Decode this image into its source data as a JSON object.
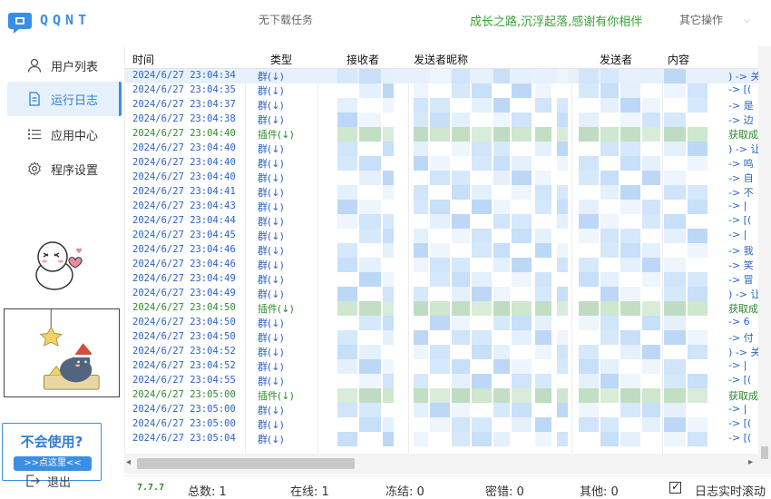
{
  "app": {
    "logo_text": "QQNT"
  },
  "topbar": {
    "task_status": "无下载任务",
    "slogan": "成长之路,沉浮起落,感谢有你相伴",
    "other_ops": "其它操作",
    "other_chev": "⌵"
  },
  "sidebar": {
    "items": [
      {
        "label": "用户列表",
        "icon": "user-icon"
      },
      {
        "label": "运行日志",
        "icon": "log-icon",
        "active": true
      },
      {
        "label": "应用中心",
        "icon": "list-icon"
      },
      {
        "label": "程序设置",
        "icon": "gear-icon"
      }
    ],
    "help_question": "不会使用?",
    "help_button": ">>点这里<<",
    "logout": "退出"
  },
  "grid": {
    "columns": [
      "时间",
      "类型",
      "接收者",
      "发送者昵称",
      "发送者",
      "内容"
    ],
    "rows": [
      {
        "time": "2024/6/27 23:04:34",
        "type": "群(↓)",
        "content": ") -> 关",
        "kind": "blue"
      },
      {
        "time": "2024/6/27 23:04:35",
        "type": "群(↓)",
        "content": "-> [(",
        "kind": "blue"
      },
      {
        "time": "2024/6/27 23:04:37",
        "type": "群(↓)",
        "content": "-> 是",
        "kind": "blue"
      },
      {
        "time": "2024/6/27 23:04:38",
        "type": "群(↓)",
        "content": "-> 边",
        "kind": "blue"
      },
      {
        "time": "2024/6/27 23:04:40",
        "type": "插件(↓)",
        "content": "获取成功",
        "kind": "green"
      },
      {
        "time": "2024/6/27 23:04:40",
        "type": "群(↓)",
        "content": ") -> 让",
        "kind": "blue"
      },
      {
        "time": "2024/6/27 23:04:40",
        "type": "群(↓)",
        "content": "-> 鸣",
        "kind": "blue"
      },
      {
        "time": "2024/6/27 23:04:40",
        "type": "群(↓)",
        "content": "-> 自",
        "kind": "blue"
      },
      {
        "time": "2024/6/27 23:04:41",
        "type": "群(↓)",
        "content": "-> 不",
        "kind": "blue"
      },
      {
        "time": "2024/6/27 23:04:43",
        "type": "群(↓)",
        "content": "-> |",
        "kind": "blue"
      },
      {
        "time": "2024/6/27 23:04:44",
        "type": "群(↓)",
        "content": "-> [(",
        "kind": "blue"
      },
      {
        "time": "2024/6/27 23:04:45",
        "type": "群(↓)",
        "content": "-> |",
        "kind": "blue"
      },
      {
        "time": "2024/6/27 23:04:46",
        "type": "群(↓)",
        "content": "-> 我",
        "kind": "blue"
      },
      {
        "time": "2024/6/27 23:04:46",
        "type": "群(↓)",
        "content": "-> 笑",
        "kind": "blue"
      },
      {
        "time": "2024/6/27 23:04:49",
        "type": "群(↓)",
        "content": "-> 冒",
        "kind": "blue"
      },
      {
        "time": "2024/6/27 23:04:49",
        "type": "群(↓)",
        "content": ") -> 让",
        "kind": "blue"
      },
      {
        "time": "2024/6/27 23:04:50",
        "type": "插件(↓)",
        "content": "获取成功",
        "kind": "green"
      },
      {
        "time": "2024/6/27 23:04:50",
        "type": "群(↓)",
        "content": "-> 6",
        "kind": "blue"
      },
      {
        "time": "2024/6/27 23:04:50",
        "type": "群(↓)",
        "content": "-> 付",
        "kind": "blue"
      },
      {
        "time": "2024/6/27 23:04:52",
        "type": "群(↓)",
        "content": ") -> 关",
        "kind": "blue"
      },
      {
        "time": "2024/6/27 23:04:52",
        "type": "群(↓)",
        "content": "-> |",
        "kind": "blue"
      },
      {
        "time": "2024/6/27 23:04:55",
        "type": "群(↓)",
        "content": "-> [(",
        "kind": "blue"
      },
      {
        "time": "2024/6/27 23:05:00",
        "type": "插件(↓)",
        "content": "获取成功",
        "kind": "green"
      },
      {
        "time": "2024/6/27 23:05:00",
        "type": "群(↓)",
        "content": "-> |",
        "kind": "blue"
      },
      {
        "time": "2024/6/27 23:05:00",
        "type": "群(↓)",
        "content": "-> [(",
        "kind": "blue"
      },
      {
        "time": "2024/6/27 23:05:04",
        "type": "群(↓)",
        "content": "-> [(",
        "kind": "blue"
      }
    ]
  },
  "status": {
    "version": "7.7.7",
    "total": "总数: 1",
    "online": "在线: 1",
    "frozen": "冻结: 0",
    "pwd_err": "密错: 0",
    "other": "其他: 0",
    "realtime_scroll": "日志实时滚动",
    "realtime_checked": "✓"
  },
  "colors": {
    "accent": "#3a8ee6",
    "green": "#2d8a2d",
    "blue_text": "#2b63c6"
  }
}
